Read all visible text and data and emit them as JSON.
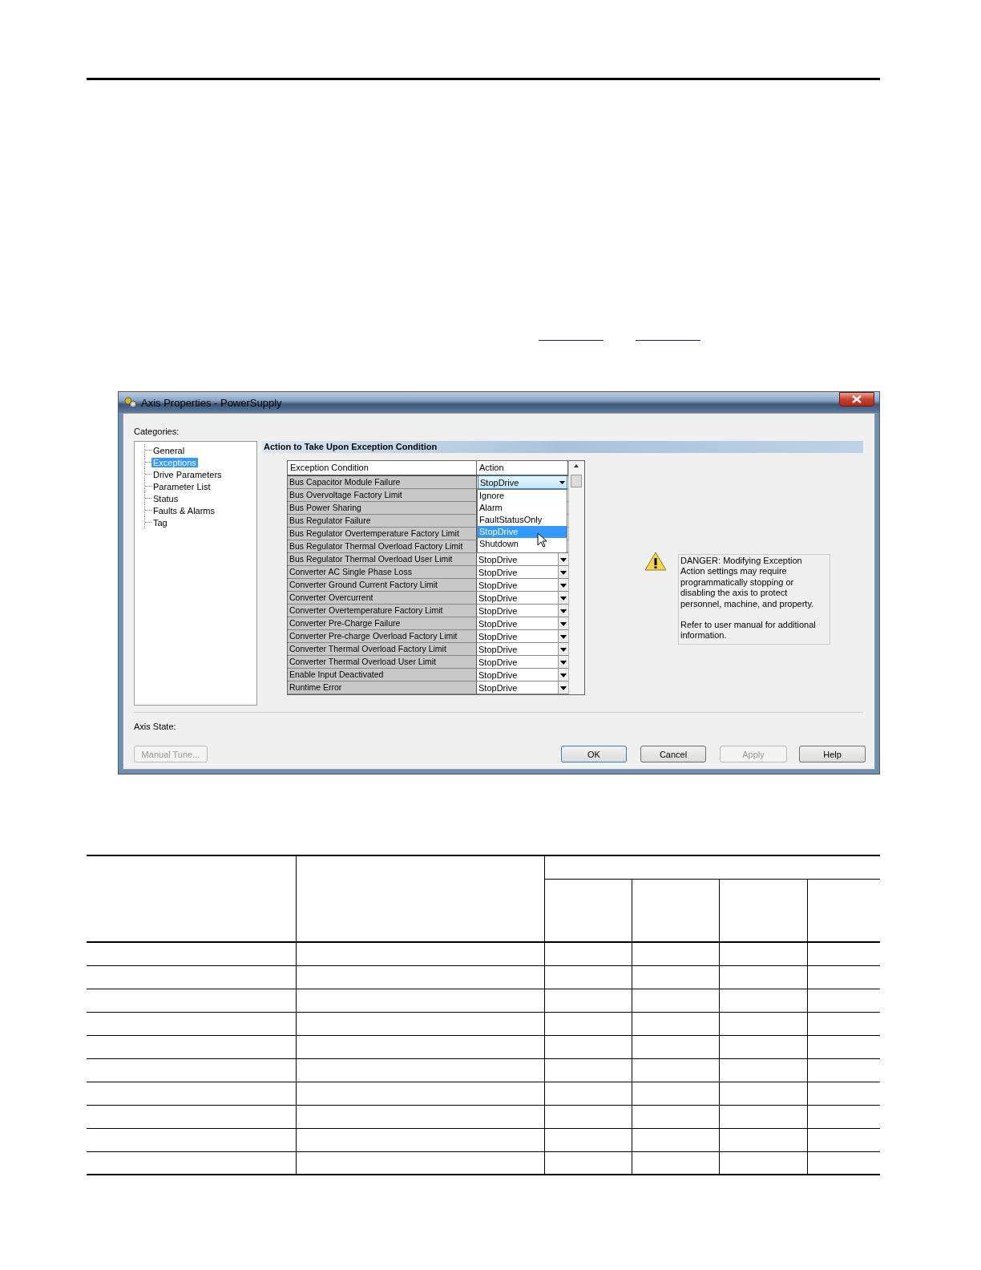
{
  "dialog": {
    "title": "Axis Properties - PowerSupply",
    "categories_label": "Categories:",
    "categories": [
      {
        "label": "General",
        "selected": false
      },
      {
        "label": "Exceptions",
        "selected": true
      },
      {
        "label": "Drive Parameters",
        "selected": false
      },
      {
        "label": "Parameter List",
        "selected": false
      },
      {
        "label": "Status",
        "selected": false
      },
      {
        "label": "Faults & Alarms",
        "selected": false
      },
      {
        "label": "Tag",
        "selected": false
      }
    ],
    "section_title": "Action to Take Upon Exception Condition",
    "table": {
      "columns": [
        "Exception Condition",
        "Action"
      ],
      "rows": [
        {
          "condition": "Bus Capacitor Module Failure",
          "action": "StopDrive",
          "dropdown": [
            {
              "label": "Ignore",
              "selected": false
            },
            {
              "label": "Alarm",
              "selected": false
            },
            {
              "label": "FaultStatusOnly",
              "selected": false
            },
            {
              "label": "StopDrive",
              "selected": true
            },
            {
              "label": "Shutdown",
              "selected": false
            }
          ]
        },
        {
          "condition": "Bus Overvoltage Factory Limit"
        },
        {
          "condition": "Bus Power Sharing"
        },
        {
          "condition": "Bus Regulator Failure"
        },
        {
          "condition": "Bus Regulator Overtemperature Factory Limit"
        },
        {
          "condition": "Bus Regulator Thermal Overload Factory Limit"
        },
        {
          "condition": "Bus Regulator Thermal Overload User Limit",
          "action": "StopDrive"
        },
        {
          "condition": "Converter AC Single Phase Loss",
          "action": "StopDrive"
        },
        {
          "condition": "Converter Ground Current Factory Limit",
          "action": "StopDrive"
        },
        {
          "condition": "Converter Overcurrent",
          "action": "StopDrive"
        },
        {
          "condition": "Converter Overtemperature Factory Limit",
          "action": "StopDrive"
        },
        {
          "condition": "Converter Pre-Charge Failure",
          "action": "StopDrive"
        },
        {
          "condition": "Converter Pre-charge Overload Factory Limit",
          "action": "StopDrive"
        },
        {
          "condition": "Converter Thermal Overload Factory Limit",
          "action": "StopDrive"
        },
        {
          "condition": "Converter Thermal Overload User Limit",
          "action": "StopDrive"
        },
        {
          "condition": "Enable Input Deactivated",
          "action": "StopDrive"
        },
        {
          "condition": "Runtime Error",
          "action": "StopDrive"
        }
      ]
    },
    "danger_text": [
      "DANGER: Modifying Exception Action settings may require programmatically stopping or disabling the axis to protect personnel, machine, and property.",
      "Refer to user manual for additional information."
    ],
    "axis_state_label": "Axis State:",
    "buttons": [
      {
        "label": "Manual Tune...",
        "disabled": true,
        "default": false
      },
      {
        "label": "OK",
        "disabled": false,
        "default": true
      },
      {
        "label": "Cancel",
        "disabled": false,
        "default": false
      },
      {
        "label": "Apply",
        "disabled": true,
        "default": false
      },
      {
        "label": "Help",
        "disabled": false,
        "default": false
      }
    ]
  }
}
